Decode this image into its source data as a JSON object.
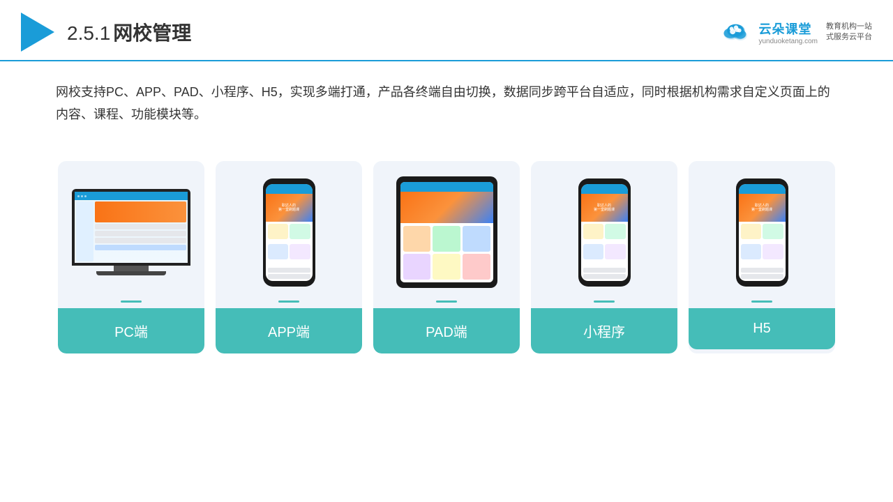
{
  "header": {
    "section_number": "2.5.1",
    "title": "网校管理",
    "brand_name": "云朵课堂",
    "brand_url": "yunduoketang.com",
    "brand_tagline": "教育机构一站\n式服务云平台"
  },
  "description": {
    "text": "网校支持PC、APP、PAD、小程序、H5，实现多端打通，产品各终端自由切换，数据同步跨平台自适应，同时根据机构需求自定义页面上的内容、课程、功能模块等。"
  },
  "cards": [
    {
      "id": "pc",
      "label": "PC端"
    },
    {
      "id": "app",
      "label": "APP端"
    },
    {
      "id": "pad",
      "label": "PAD端"
    },
    {
      "id": "miniprogram",
      "label": "小程序"
    },
    {
      "id": "h5",
      "label": "H5"
    }
  ]
}
